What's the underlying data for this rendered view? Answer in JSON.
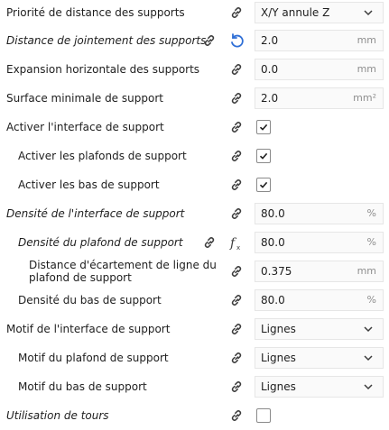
{
  "settings": [
    {
      "label": "Priorité de distance des supports",
      "value": "X/Y annule Z"
    },
    {
      "label": "Distance de jointement des supports",
      "value": "2.0",
      "unit": "mm"
    },
    {
      "label": "Expansion horizontale des supports",
      "value": "0.0",
      "unit": "mm"
    },
    {
      "label": "Surface minimale de support",
      "value": "2.0",
      "unit": "mm²"
    },
    {
      "label": "Activer l'interface de support",
      "checked": true
    },
    {
      "label": "Activer les plafonds de support",
      "checked": true
    },
    {
      "label": "Activer les bas de support",
      "checked": true
    },
    {
      "label": "Densité de l'interface de support",
      "value": "80.0",
      "unit": "%"
    },
    {
      "label": "Densité du plafond de support",
      "value": "80.0",
      "unit": "%"
    },
    {
      "label": "Distance d'écartement de ligne du plafond de support",
      "value": "0.375",
      "unit": "mm"
    },
    {
      "label": "Densité du bas de support",
      "value": "80.0",
      "unit": "%"
    },
    {
      "label": "Motif de l'interface de support",
      "value": "Lignes"
    },
    {
      "label": "Motif du plafond de support",
      "value": "Lignes"
    },
    {
      "label": "Motif du bas de support",
      "value": "Lignes"
    },
    {
      "label": "Utilisation de tours",
      "checked": false
    }
  ],
  "icons": {
    "link": "link-icon",
    "reset": "reset-icon",
    "function": "function-icon",
    "chevron": "chevron-down-icon",
    "check": "checkmark-icon"
  },
  "colors": {
    "reset_icon": "#2f6fd6",
    "icon": "#3c3c3c",
    "unit": "#8e8e8e"
  }
}
